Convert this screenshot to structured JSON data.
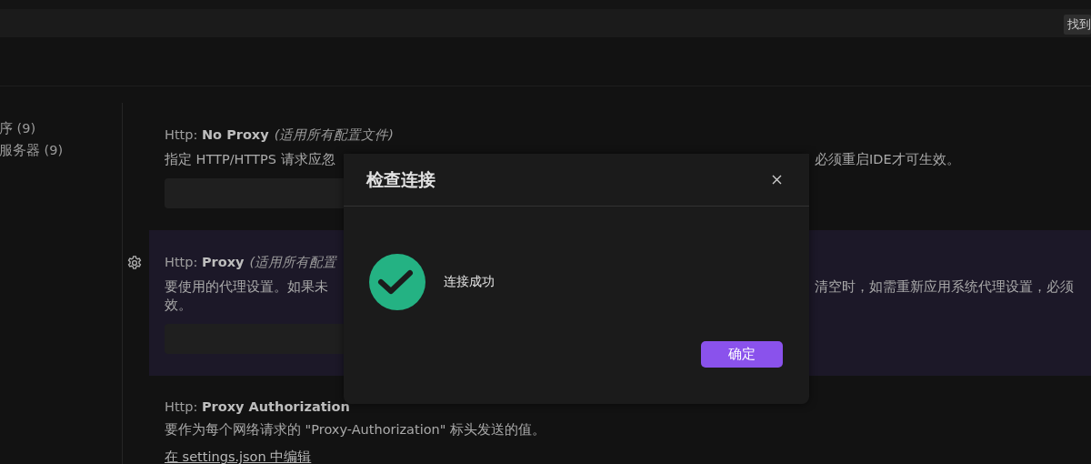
{
  "find_badge": "找到",
  "sidebar": {
    "items": [
      {
        "label": "序 (9)"
      },
      {
        "label": "服务器 (9)"
      }
    ]
  },
  "settings": [
    {
      "kind": "field",
      "prefix": "Http: ",
      "name": "No Proxy",
      "scope": "(适用所有配置文件)",
      "highlighted": false,
      "description_lines": [
        {
          "left": "指定 HTTP/HTTPS 请求应忽",
          "right": "必须重启IDE才可生效。"
        }
      ]
    },
    {
      "kind": "field",
      "prefix": "Http: ",
      "name": "Proxy",
      "scope": "(适用所有配置",
      "highlighted": true,
      "description_lines": [
        {
          "left": "要使用的代理设置。如果未",
          "right": "清空时，如需重新应用系统代理设置，必须"
        },
        {
          "left": "效。"
        }
      ]
    },
    {
      "kind": "link",
      "prefix": "Http: ",
      "name": "Proxy Authorization",
      "highlighted": false,
      "description_lines": [
        {
          "left": "要作为每个网络请求的 \"Proxy-Authorization\" 标头发送的值。"
        }
      ],
      "link": "在 settings.json 中编辑"
    }
  ],
  "dialog": {
    "title": "检查连接",
    "message": "连接成功",
    "button": "确定"
  }
}
